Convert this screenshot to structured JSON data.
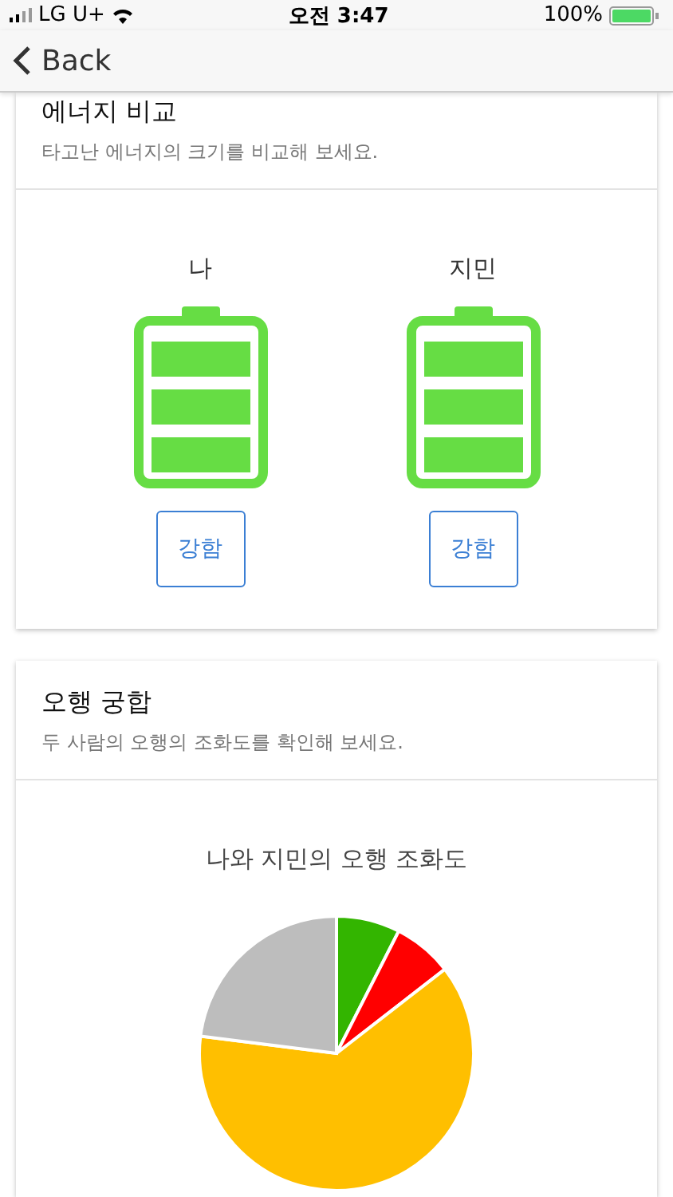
{
  "status_bar": {
    "carrier": "LG U+",
    "time": "오전 3:47",
    "battery": "100%"
  },
  "nav": {
    "back": "Back"
  },
  "energy_card": {
    "title": "에너지 비교",
    "subtitle": "타고난 에너지의 크기를 비교해 보세요.",
    "people": [
      {
        "name": "나",
        "level": 1,
        "button": "강함"
      },
      {
        "name": "지민",
        "level": 1,
        "button": "강함"
      }
    ]
  },
  "five_elements_card": {
    "title": "오행 궁합",
    "subtitle": "두 사람의 오행의 조화도를 확인해 보세요.",
    "chart_title": "나와 지민의 오행 조화도"
  }
}
